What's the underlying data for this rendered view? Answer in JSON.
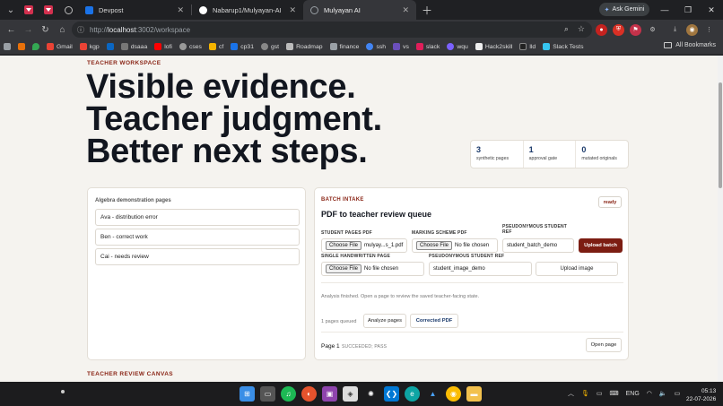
{
  "browser": {
    "tabs": [
      {
        "title": "Devpost",
        "icon": "devpost-icon",
        "color": "#1a73e8"
      },
      {
        "title": "Nabarup1/Mulyayan-AI",
        "icon": "github-icon",
        "color": "#ffffff"
      },
      {
        "title": "Mulyayan AI",
        "icon": "globe-icon",
        "color": "#9aa0a6",
        "active": true
      }
    ],
    "ask_gemini": "Ask Gemini",
    "url_scheme": "http://",
    "url_host": "localhost",
    "url_path": ":3002/workspace",
    "bookmarks": [
      "Gmail",
      "kgp",
      "dsaaa",
      "lofi",
      "cses",
      "cf",
      "cp31",
      "gst",
      "Roadmap",
      "finance",
      "ssh",
      "vs",
      "slack",
      "wqu",
      "Hack2skill",
      "lld",
      "Slack Tests"
    ],
    "all_bookmarks": "All Bookmarks"
  },
  "page": {
    "eyebrow": "TEACHER WORKSPACE",
    "hero_lines": [
      "Visible evidence.",
      "Teacher judgment.",
      "Better next steps."
    ],
    "stats": [
      {
        "value": "3",
        "label": "synthetic pages"
      },
      {
        "value": "1",
        "label": "approval gate"
      },
      {
        "value": "0",
        "label": "mutated originals"
      }
    ],
    "left_card": {
      "heading": "Algebra demonstration pages",
      "items": [
        "Ava - distribution error",
        "Ben - correct work",
        "Cai - needs review"
      ]
    },
    "intake": {
      "kicker": "BATCH INTAKE",
      "status": "ready",
      "title": "PDF to teacher review queue",
      "student_pages_label": "STUDENT PAGES PDF",
      "choose_file": "Choose File",
      "student_pages_file": "mulyay...s_1.pdf",
      "marking_scheme_label": "MARKING SCHEME PDF",
      "no_file": "No file chosen",
      "pseudo_ref_label": "PSEUDONYMOUS STUDENT REF",
      "pseudo_ref_batch": "student_batch_demo",
      "upload_batch": "Upload batch",
      "single_label": "SINGLE HANDWRITTEN PAGE",
      "pseudo_ref_image": "student_image_demo",
      "upload_image": "Upload image",
      "analysis_note": "Analysis finished. Open a page to review the saved teacher-facing state.",
      "queued": "1 pages queued",
      "analyze": "Analyze pages",
      "corrected": "Corrected PDF",
      "page_label": "Page 1",
      "page_status": "SUCCEEDED; PASS",
      "open_page": "Open page"
    },
    "canvas_heading": "TEACHER REVIEW CANVAS"
  },
  "taskbar": {
    "lang": "ENG",
    "time": "05:13",
    "date": "22-07-2026"
  },
  "colors": {
    "accent_red": "#8a2617",
    "button_dark": "#7c1d12",
    "stat_blue": "#1b3a6b",
    "page_bg": "#f5f3ef"
  }
}
